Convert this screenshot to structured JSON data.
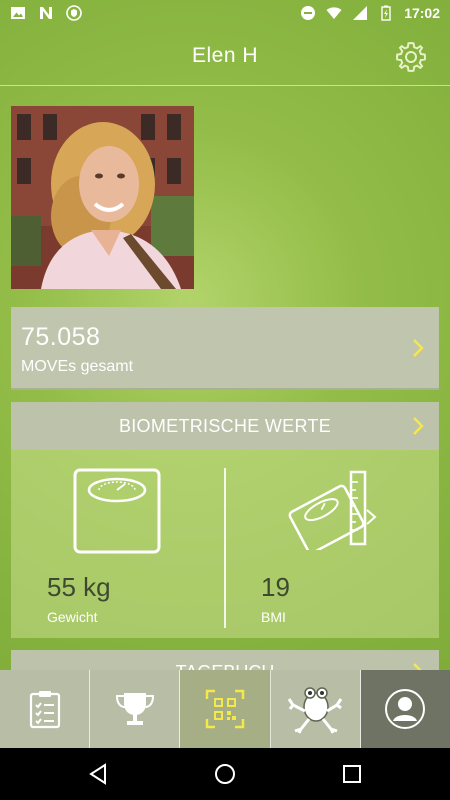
{
  "status_bar": {
    "time": "17:02",
    "left_icons": [
      "image-icon",
      "n-icon",
      "shield-icon"
    ],
    "right_icons": [
      "dnd-icon",
      "wifi-icon",
      "signal-icon",
      "battery-icon"
    ]
  },
  "header": {
    "title": "Elen H",
    "settings_icon": "gear-icon"
  },
  "profile": {
    "avatar": "profile-photo"
  },
  "moves_card": {
    "value": "75.058",
    "label": "MOVEs gesamt"
  },
  "biometrics": {
    "title": "BIOMETRISCHE WERTE",
    "weight": {
      "value": "55 kg",
      "label": "Gewicht",
      "icon": "scale-icon"
    },
    "bmi": {
      "value": "19",
      "label": "BMI",
      "icon": "scale-ruler-icon"
    }
  },
  "diary": {
    "title": "TAGEBUCH"
  },
  "bottom_nav": {
    "items": [
      {
        "icon": "clipboard-icon",
        "active": false
      },
      {
        "icon": "trophy-icon",
        "active": false
      },
      {
        "icon": "qr-scan-icon",
        "active": true
      },
      {
        "icon": "frog-icon",
        "active": false
      },
      {
        "icon": "profile-icon",
        "active": false
      }
    ]
  },
  "system_nav": [
    "back-icon",
    "home-icon",
    "recents-icon"
  ],
  "colors": {
    "background": "#86b23f",
    "card": "#bfc6ad",
    "value_text": "#3d4a2f"
  }
}
